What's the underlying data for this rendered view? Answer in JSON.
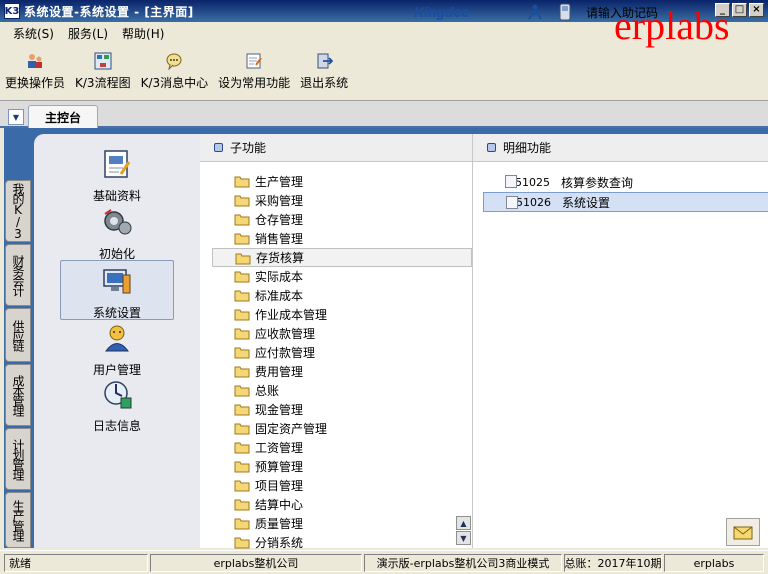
{
  "window": {
    "title": "系统设置-系统设置 - [主界面]",
    "app_icon": "K3"
  },
  "menu": [
    {
      "label": "系统(S)"
    },
    {
      "label": "服务(L)"
    },
    {
      "label": "帮助(H)"
    }
  ],
  "header": {
    "brand": "Kingdee",
    "login_text": "请输入助记码",
    "watermark": "erplabs"
  },
  "toolbar": [
    {
      "label": "更换操作员",
      "icon": "change-operator-icon"
    },
    {
      "label": "K/3流程图",
      "icon": "flowchart-icon"
    },
    {
      "label": "K/3消息中心",
      "icon": "message-center-icon"
    },
    {
      "label": "设为常用功能",
      "icon": "favorite-function-icon"
    },
    {
      "label": "退出系统",
      "icon": "exit-icon"
    }
  ],
  "tabs": {
    "main": "主控台"
  },
  "side_tabs": [
    "我的K/3",
    "财务会计",
    "供应链",
    "成本管理",
    "计划管理",
    "生产管理"
  ],
  "modules": [
    {
      "label": "基础资料",
      "icon": "basic-data-icon"
    },
    {
      "label": "初始化",
      "icon": "initialization-icon"
    },
    {
      "label": "系统设置",
      "icon": "system-settings-icon",
      "selected": true
    },
    {
      "label": "用户管理",
      "icon": "user-management-icon"
    },
    {
      "label": "日志信息",
      "icon": "log-info-icon"
    }
  ],
  "sub_panel": {
    "title": "子功能",
    "items": [
      "生产管理",
      "采购管理",
      "仓存管理",
      "销售管理",
      "存货核算",
      "实际成本",
      "标准成本",
      "作业成本管理",
      "应收款管理",
      "应付款管理",
      "费用管理",
      "总账",
      "现金管理",
      "固定资产管理",
      "工资管理",
      "预算管理",
      "项目管理",
      "结算中心",
      "质量管理",
      "分销系统"
    ],
    "selected_index": 4
  },
  "detail_panel": {
    "title": "明细功能",
    "items": [
      {
        "code": "51025",
        "name": "核算参数查询"
      },
      {
        "code": "51026",
        "name": "系统设置",
        "selected": true
      }
    ]
  },
  "status": {
    "state": "就绪",
    "company": "erplabs整机公司",
    "mode": "演示版-erplabs整机公司3商业模式",
    "period": "总账：2017年10期",
    "user": "erplabs"
  }
}
